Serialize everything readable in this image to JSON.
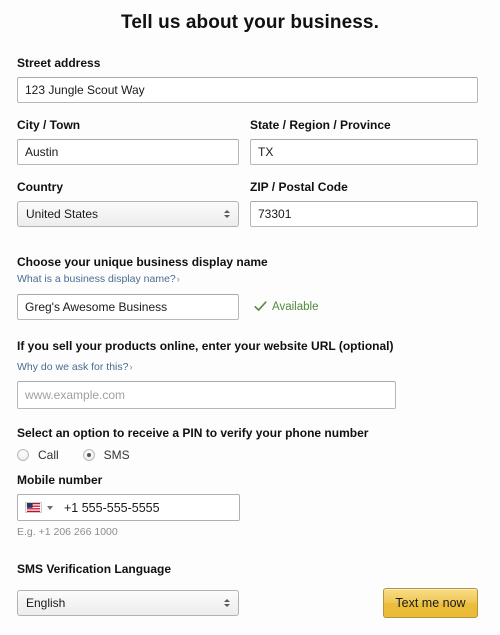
{
  "page": {
    "title": "Tell us about your business."
  },
  "form": {
    "street": {
      "label": "Street address",
      "value": "123 Jungle Scout Way"
    },
    "city": {
      "label": "City / Town",
      "value": "Austin"
    },
    "state": {
      "label": "State / Region / Province",
      "value": "TX"
    },
    "country": {
      "label": "Country",
      "value": "United States",
      "control": "select"
    },
    "zip": {
      "label": "ZIP / Postal Code",
      "value": "73301"
    },
    "display_name": {
      "label": "Choose your unique business display name",
      "help_link": "What is a business display name?",
      "help_chevron": "›",
      "value": "Greg's Awesome Business",
      "status_text": "Available",
      "status_icon": "check-icon",
      "status_color": "#4f8a3d"
    },
    "website": {
      "label": "If you sell your products online, enter your website URL (optional)",
      "help_link": "Why do we ask for this?",
      "help_chevron": "›",
      "value": "",
      "placeholder": "www.example.com"
    },
    "pin_option": {
      "label": "Select an option to receive a PIN to verify your phone number",
      "options": [
        {
          "label": "Call",
          "selected": false
        },
        {
          "label": "SMS",
          "selected": true
        }
      ]
    },
    "mobile": {
      "label": "Mobile number",
      "country_flag": "us-flag-icon",
      "value": "+1 555-555-5555",
      "hint": "E.g. +1 206 266 1000"
    },
    "sms_language": {
      "label": "SMS Verification Language",
      "value": "English",
      "control": "select"
    },
    "submit": {
      "label": "Text me now",
      "accent_color": "#eabd3c"
    }
  }
}
